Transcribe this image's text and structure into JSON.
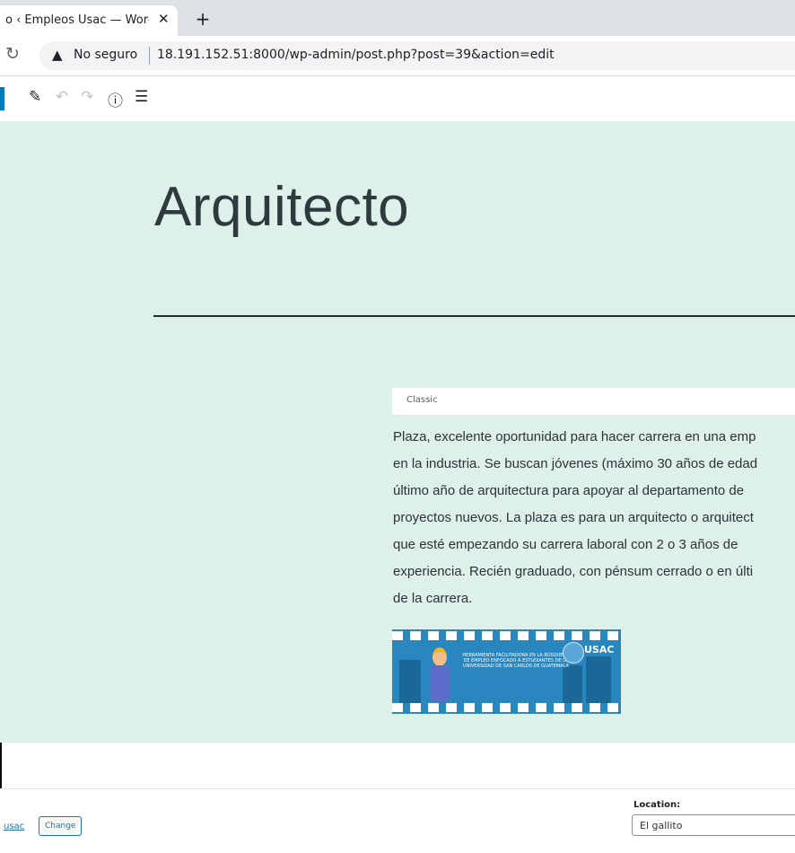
{
  "browser": {
    "tab_title": "o ‹ Empleos Usac — Word",
    "tab_close": "✕",
    "new_tab": "+",
    "security_label": "No seguro",
    "url": "18.191.152.51:8000/wp-admin/post.php?post=39&action=edit"
  },
  "toolbar": {
    "icons": [
      "edit-icon",
      "undo-icon",
      "redo-icon",
      "info-icon",
      "list-view-icon"
    ]
  },
  "post": {
    "title": "Arquitecto",
    "block_label": "Classic",
    "content_lines": [
      "Plaza, excelente oportunidad para hacer carrera en una emp",
      "en la industria. Se buscan jóvenes (máximo 30 años de edad",
      "último año de arquitectura para apoyar al departamento de",
      "proyectos nuevos. La plaza es para un arquitecto o arquitect",
      "que esté empezando su carrera laboral con 2 o 3 años de",
      "experiencia. Recién graduado, con pénsum cerrado o en últi",
      "de la carrera."
    ],
    "banner": {
      "text": "HERRAMIENTA FACILITADORA EN LA BÚSQUEDA DE EMPLEO ENFOCADO A ESTUDIANTES DE LA UNIVERSIDAD DE SAN CARLOS DE GUATEMALA",
      "logo_text": "USAC",
      "primary_color": "#2a86bf"
    }
  },
  "meta": {
    "author_link": "usac",
    "change_button": "Change",
    "location_label": "Location:",
    "location_value": "El gallito"
  },
  "colors": {
    "canvas_background": "#ddf0e9",
    "accent": "#007cba"
  }
}
